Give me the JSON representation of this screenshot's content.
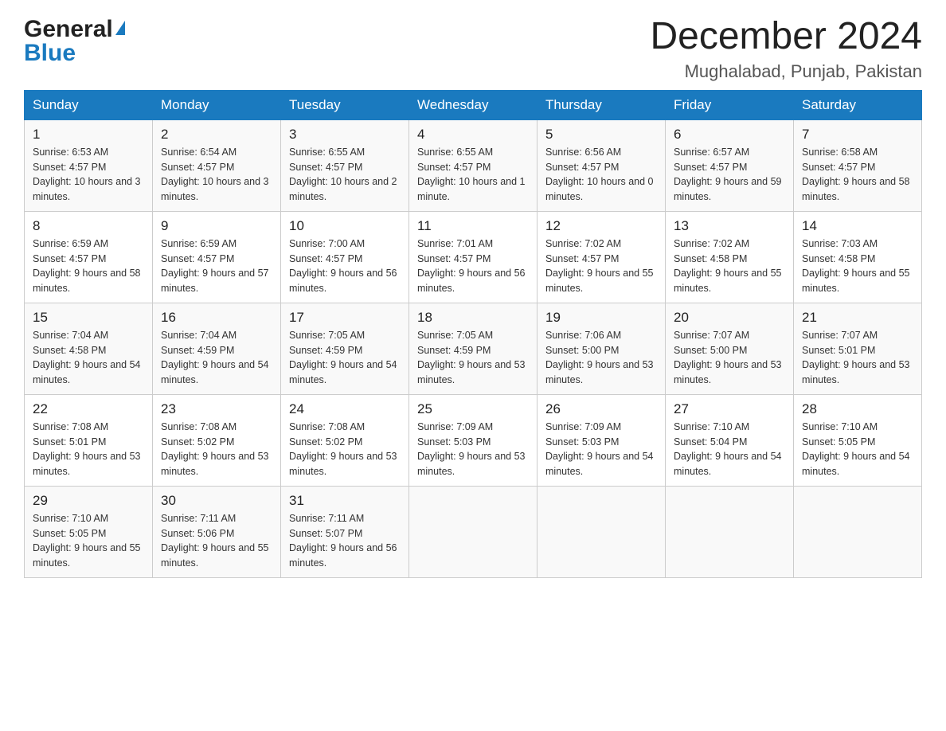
{
  "header": {
    "logo_general": "General",
    "logo_blue": "Blue",
    "month_title": "December 2024",
    "location": "Mughalabad, Punjab, Pakistan"
  },
  "weekdays": [
    "Sunday",
    "Monday",
    "Tuesday",
    "Wednesday",
    "Thursday",
    "Friday",
    "Saturday"
  ],
  "weeks": [
    [
      {
        "day": "1",
        "sunrise": "6:53 AM",
        "sunset": "4:57 PM",
        "daylight": "10 hours and 3 minutes."
      },
      {
        "day": "2",
        "sunrise": "6:54 AM",
        "sunset": "4:57 PM",
        "daylight": "10 hours and 3 minutes."
      },
      {
        "day": "3",
        "sunrise": "6:55 AM",
        "sunset": "4:57 PM",
        "daylight": "10 hours and 2 minutes."
      },
      {
        "day": "4",
        "sunrise": "6:55 AM",
        "sunset": "4:57 PM",
        "daylight": "10 hours and 1 minute."
      },
      {
        "day": "5",
        "sunrise": "6:56 AM",
        "sunset": "4:57 PM",
        "daylight": "10 hours and 0 minutes."
      },
      {
        "day": "6",
        "sunrise": "6:57 AM",
        "sunset": "4:57 PM",
        "daylight": "9 hours and 59 minutes."
      },
      {
        "day": "7",
        "sunrise": "6:58 AM",
        "sunset": "4:57 PM",
        "daylight": "9 hours and 58 minutes."
      }
    ],
    [
      {
        "day": "8",
        "sunrise": "6:59 AM",
        "sunset": "4:57 PM",
        "daylight": "9 hours and 58 minutes."
      },
      {
        "day": "9",
        "sunrise": "6:59 AM",
        "sunset": "4:57 PM",
        "daylight": "9 hours and 57 minutes."
      },
      {
        "day": "10",
        "sunrise": "7:00 AM",
        "sunset": "4:57 PM",
        "daylight": "9 hours and 56 minutes."
      },
      {
        "day": "11",
        "sunrise": "7:01 AM",
        "sunset": "4:57 PM",
        "daylight": "9 hours and 56 minutes."
      },
      {
        "day": "12",
        "sunrise": "7:02 AM",
        "sunset": "4:57 PM",
        "daylight": "9 hours and 55 minutes."
      },
      {
        "day": "13",
        "sunrise": "7:02 AM",
        "sunset": "4:58 PM",
        "daylight": "9 hours and 55 minutes."
      },
      {
        "day": "14",
        "sunrise": "7:03 AM",
        "sunset": "4:58 PM",
        "daylight": "9 hours and 55 minutes."
      }
    ],
    [
      {
        "day": "15",
        "sunrise": "7:04 AM",
        "sunset": "4:58 PM",
        "daylight": "9 hours and 54 minutes."
      },
      {
        "day": "16",
        "sunrise": "7:04 AM",
        "sunset": "4:59 PM",
        "daylight": "9 hours and 54 minutes."
      },
      {
        "day": "17",
        "sunrise": "7:05 AM",
        "sunset": "4:59 PM",
        "daylight": "9 hours and 54 minutes."
      },
      {
        "day": "18",
        "sunrise": "7:05 AM",
        "sunset": "4:59 PM",
        "daylight": "9 hours and 53 minutes."
      },
      {
        "day": "19",
        "sunrise": "7:06 AM",
        "sunset": "5:00 PM",
        "daylight": "9 hours and 53 minutes."
      },
      {
        "day": "20",
        "sunrise": "7:07 AM",
        "sunset": "5:00 PM",
        "daylight": "9 hours and 53 minutes."
      },
      {
        "day": "21",
        "sunrise": "7:07 AM",
        "sunset": "5:01 PM",
        "daylight": "9 hours and 53 minutes."
      }
    ],
    [
      {
        "day": "22",
        "sunrise": "7:08 AM",
        "sunset": "5:01 PM",
        "daylight": "9 hours and 53 minutes."
      },
      {
        "day": "23",
        "sunrise": "7:08 AM",
        "sunset": "5:02 PM",
        "daylight": "9 hours and 53 minutes."
      },
      {
        "day": "24",
        "sunrise": "7:08 AM",
        "sunset": "5:02 PM",
        "daylight": "9 hours and 53 minutes."
      },
      {
        "day": "25",
        "sunrise": "7:09 AM",
        "sunset": "5:03 PM",
        "daylight": "9 hours and 53 minutes."
      },
      {
        "day": "26",
        "sunrise": "7:09 AM",
        "sunset": "5:03 PM",
        "daylight": "9 hours and 54 minutes."
      },
      {
        "day": "27",
        "sunrise": "7:10 AM",
        "sunset": "5:04 PM",
        "daylight": "9 hours and 54 minutes."
      },
      {
        "day": "28",
        "sunrise": "7:10 AM",
        "sunset": "5:05 PM",
        "daylight": "9 hours and 54 minutes."
      }
    ],
    [
      {
        "day": "29",
        "sunrise": "7:10 AM",
        "sunset": "5:05 PM",
        "daylight": "9 hours and 55 minutes."
      },
      {
        "day": "30",
        "sunrise": "7:11 AM",
        "sunset": "5:06 PM",
        "daylight": "9 hours and 55 minutes."
      },
      {
        "day": "31",
        "sunrise": "7:11 AM",
        "sunset": "5:07 PM",
        "daylight": "9 hours and 56 minutes."
      },
      null,
      null,
      null,
      null
    ]
  ]
}
